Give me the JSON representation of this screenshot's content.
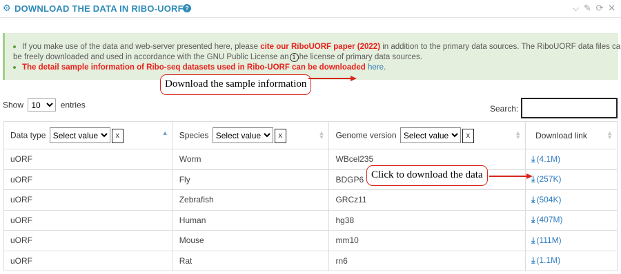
{
  "panel": {
    "title": "DOWNLOAD THE DATA IN RIBO-UORF",
    "help": "?",
    "tools": [
      "⌵",
      "✎",
      "⟳",
      "✕"
    ]
  },
  "notice": {
    "line1_pre": "If you make use of the data and web-server presented here, please ",
    "line1_cite": "cite our RiboUORF paper (2022)",
    "line1_post": " in addition to the primary data sources. The RiboUORF data files can",
    "line2_pre": "be freely downloaded and used in accordance with the GNU Public License an",
    "marker": "1",
    "line2_post": "he license of primary data sources.",
    "line3_red": "The detail sample information of Ribo-seq datasets used in Ribo-UORF can be downloaded",
    "line3_link": "here",
    "line3_end": "."
  },
  "callouts": {
    "sample_info": "Download the sample information",
    "click_download": "Click to download the data"
  },
  "controls": {
    "show_label": "Show",
    "entries_value": "10",
    "entries_label": "entries",
    "search_label": "Search:"
  },
  "table": {
    "columns": [
      {
        "label": "Data type",
        "filter": "Select value",
        "clear": "x"
      },
      {
        "label": "Species",
        "filter": "Select value",
        "clear": "x"
      },
      {
        "label": "Genome version",
        "filter": "Select value",
        "clear": "x"
      },
      {
        "label": "Download link"
      }
    ],
    "rows": [
      {
        "type": "uORF",
        "species": "Worm",
        "genome": "WBcel235",
        "size": "(4.1M)"
      },
      {
        "type": "uORF",
        "species": "Fly",
        "genome": "BDGP6",
        "size": "(257K)"
      },
      {
        "type": "uORF",
        "species": "Zebrafish",
        "genome": "GRCz11",
        "size": "(504K)"
      },
      {
        "type": "uORF",
        "species": "Human",
        "genome": "hg38",
        "size": "(407M)"
      },
      {
        "type": "uORF",
        "species": "Mouse",
        "genome": "mm10",
        "size": "(111M)"
      },
      {
        "type": "uORF",
        "species": "Rat",
        "genome": "rn6",
        "size": "(1.1M)"
      }
    ]
  },
  "icons": {
    "header": "cogs-icon",
    "download": "download-icon"
  },
  "colors": {
    "title": "#2e8bb8",
    "notice_bg": "#e4efdd",
    "accent_red": "#e8201c",
    "link": "#2f7cc0"
  }
}
